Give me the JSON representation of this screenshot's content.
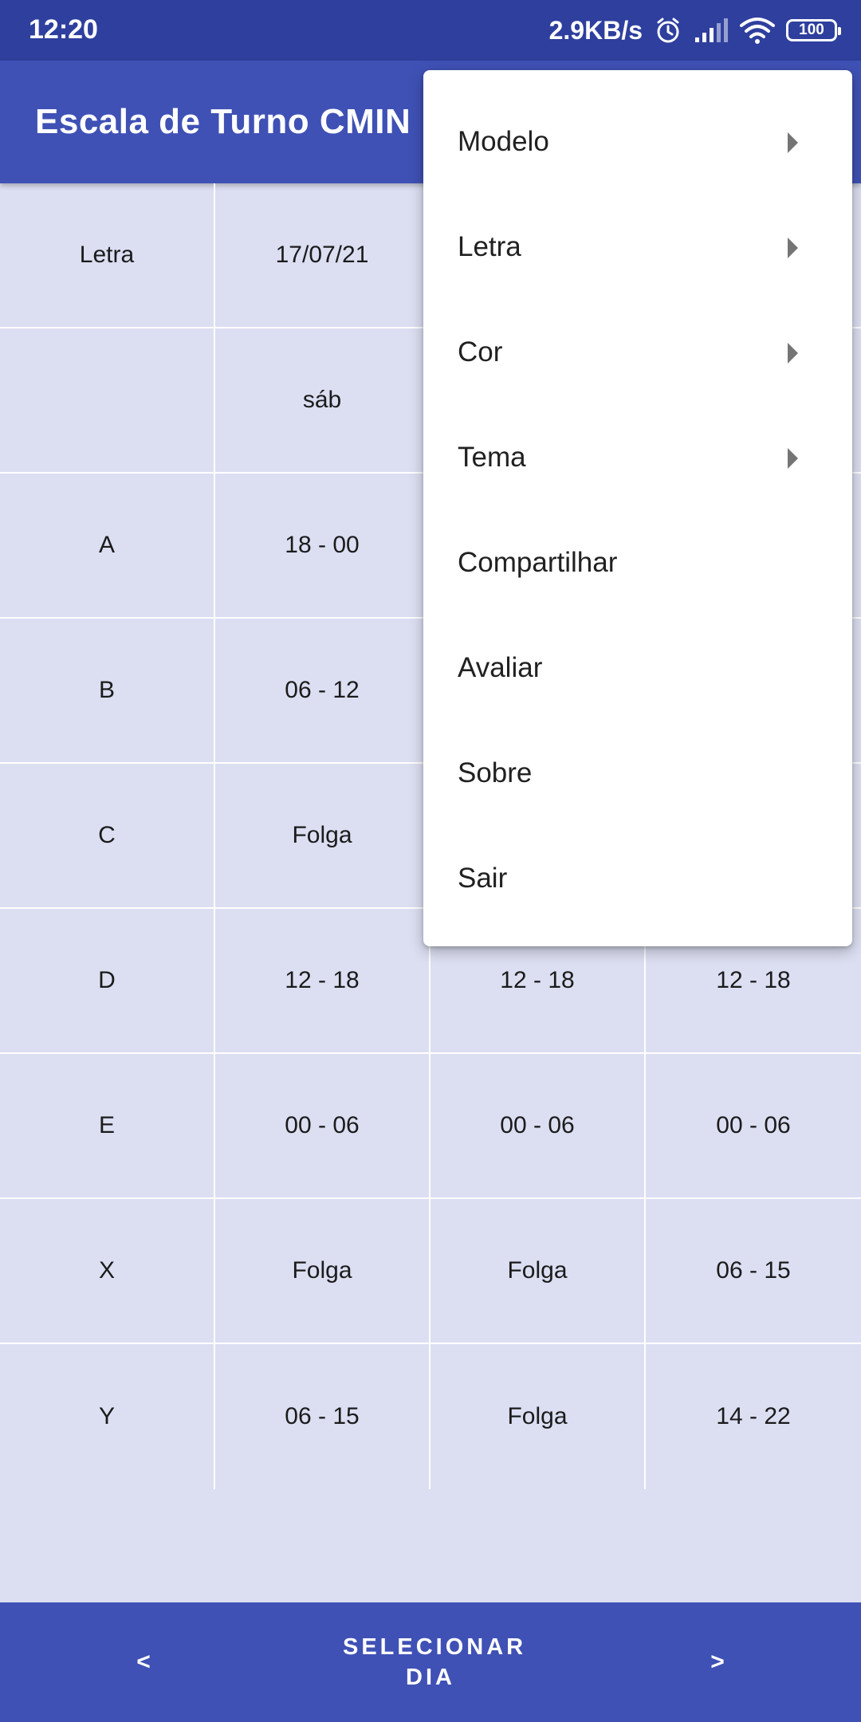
{
  "status_bar": {
    "time": "12:20",
    "speed": "2.9KB/s",
    "battery": "100"
  },
  "app_bar": {
    "title": "Escala de Turno CMIN"
  },
  "table": {
    "rows": [
      [
        "Letra",
        "17/07/21",
        "",
        ""
      ],
      [
        "",
        "sáb",
        "",
        ""
      ],
      [
        "A",
        "18 - 00",
        "",
        ""
      ],
      [
        "B",
        "06 - 12",
        "",
        ""
      ],
      [
        "C",
        "Folga",
        "",
        ""
      ],
      [
        "D",
        "12 - 18",
        "12 - 18",
        "12 - 18"
      ],
      [
        "E",
        "00 - 06",
        "00 - 06",
        "00 - 06"
      ],
      [
        "X",
        "Folga",
        "Folga",
        "06 - 15"
      ],
      [
        "Y",
        "06 - 15",
        "Folga",
        "14 - 22"
      ]
    ]
  },
  "menu": {
    "items": [
      {
        "label": "Modelo",
        "submenu": true
      },
      {
        "label": "Letra",
        "submenu": true
      },
      {
        "label": "Cor",
        "submenu": true
      },
      {
        "label": "Tema",
        "submenu": true
      },
      {
        "label": "Compartilhar",
        "submenu": false
      },
      {
        "label": "Avaliar",
        "submenu": false
      },
      {
        "label": "Sobre",
        "submenu": false
      },
      {
        "label": "Sair",
        "submenu": false
      }
    ]
  },
  "bottom_bar": {
    "prev_label": "<",
    "select_day_label": "SELECIONAR DIA",
    "next_label": ">"
  },
  "colors": {
    "status_bar": "#2e3f9e",
    "primary": "#3f51b5",
    "table_background": "#dcdff2"
  },
  "icons": [
    "alarm-icon",
    "signal-icon",
    "wifi-icon",
    "battery-icon",
    "submenu-arrow-icon"
  ]
}
